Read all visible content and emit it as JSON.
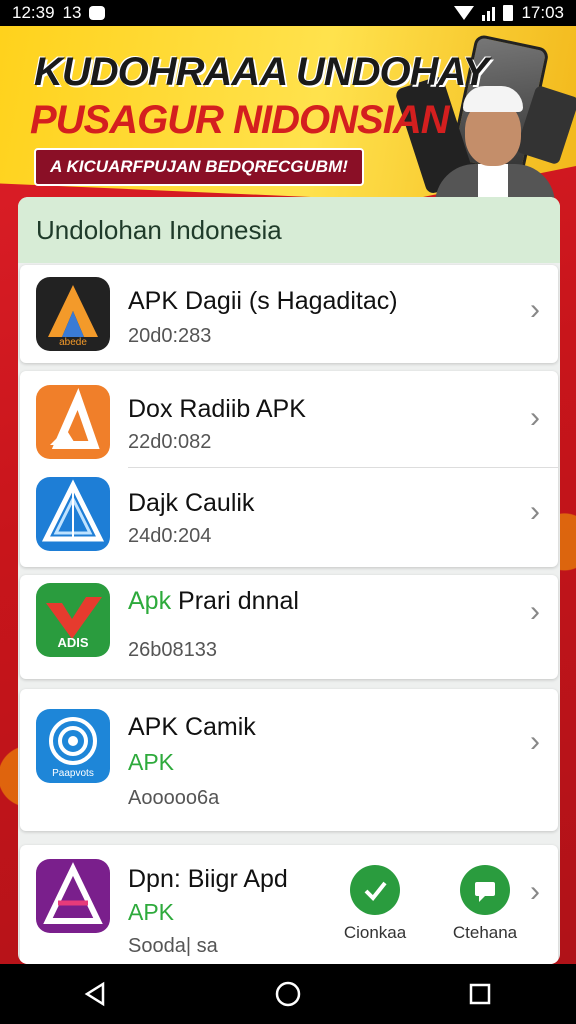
{
  "status_bar": {
    "time_left": "12:39",
    "carrier_glyph": "13",
    "time_right": "17:03"
  },
  "banner": {
    "title_1": "KUDOHRAAA UNDOHAY",
    "title_2": "PUSAGUR NIDONSIAN",
    "subtitle": "A KICUARFPUJAN BEDQRECGUBM!"
  },
  "panel": {
    "header": "Undolohan Indonesia"
  },
  "apps": [
    {
      "name": "APK Dagii (s Hagaditac)",
      "sub": "20d0:283",
      "icon_text": "abede",
      "icon": "triangle-a-icon",
      "color": "#f39a2a"
    },
    {
      "name": "Dox Radiib APK",
      "sub": "22d0:082",
      "icon_text": "",
      "icon": "orange-triangle-icon",
      "color": "#f07f2a"
    },
    {
      "name": "Dajk Caulik",
      "sub": "24d0:204",
      "icon_text": "",
      "icon": "crystal-triangle-icon",
      "color": "#1e7ed6"
    },
    {
      "name_green": "Apk",
      "name": "Prari dnnal",
      "sub": "26b08133",
      "icon_text": "ADIS",
      "icon": "green-v-icon",
      "color": "#2a9c3e"
    },
    {
      "name": "APK Camik",
      "green_line": "APK",
      "sub": "Aooooo6a",
      "icon_text": "Paapvots",
      "icon": "spiral-icon",
      "color": "#1e86d8"
    },
    {
      "name": "Dpn: Biigr Apd",
      "green_line": "APK",
      "sub": "Sooda| sa",
      "icon_text": "",
      "icon": "purple-a-icon",
      "color": "#7a1f8c"
    }
  ],
  "quick_actions": [
    {
      "label": "Cionkaa",
      "icon": "check-chat-icon"
    },
    {
      "label": "Ctehana",
      "icon": "message-icon"
    }
  ],
  "nav": {
    "back": "back-icon",
    "home": "home-icon",
    "recents": "recents-icon"
  }
}
